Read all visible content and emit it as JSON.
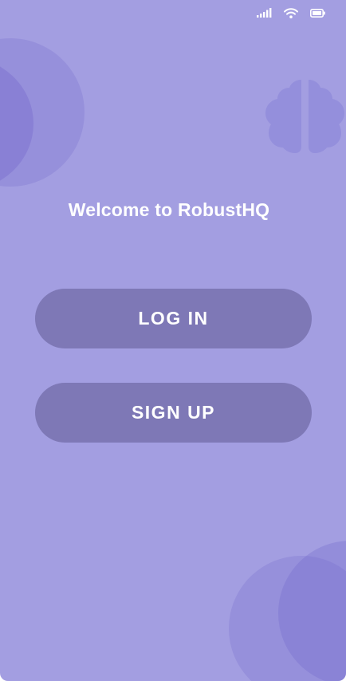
{
  "status_bar": {
    "icons": [
      "cellular-signal-icon",
      "wifi-icon",
      "battery-icon"
    ]
  },
  "welcome": {
    "title": "Welcome to RobustHQ"
  },
  "actions": {
    "login_label": "LOG IN",
    "signup_label": "SIGN UP"
  },
  "colors": {
    "background": "#a39ee1",
    "button": "#7e78b6",
    "text": "#ffffff",
    "decoration": "#8b84d6"
  }
}
